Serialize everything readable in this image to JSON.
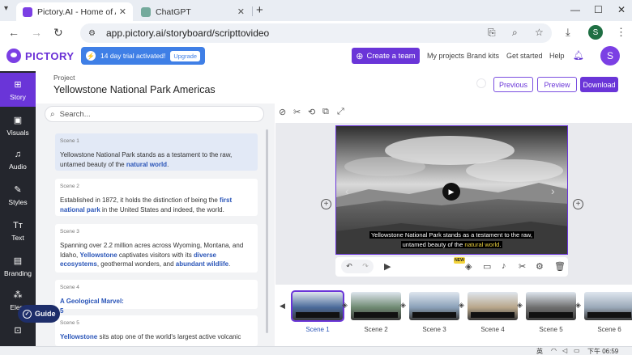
{
  "browser": {
    "tabs": [
      {
        "title": "Pictory.AI - Home of AI Vid",
        "active": true,
        "favicon_color": "#7b3fe4"
      },
      {
        "title": "ChatGPT",
        "active": false,
        "favicon_color": "#74aa9c"
      }
    ],
    "url": "app.pictory.ai/storyboard/scripttovideo",
    "profile_initial": "S"
  },
  "header": {
    "logo_text": "PICTORY",
    "trial_text": "14 day trial activated!",
    "upgrade_label": "Upgrade",
    "create_team_label": "Create a team",
    "links": [
      "My projects",
      "Brand kits",
      "Get started",
      "Help"
    ],
    "avatar_initial": "S"
  },
  "sidebar": {
    "items": [
      {
        "label": "Story",
        "icon": "grid-icon",
        "active": true
      },
      {
        "label": "Visuals",
        "icon": "image-icon",
        "active": false
      },
      {
        "label": "Audio",
        "icon": "audio-icon",
        "active": false
      },
      {
        "label": "Styles",
        "icon": "brush-icon",
        "active": false
      },
      {
        "label": "Text",
        "icon": "text-icon",
        "active": false
      },
      {
        "label": "Branding",
        "icon": "briefcase-icon",
        "active": false
      },
      {
        "label": "Elem",
        "icon": "elements-icon",
        "active": false
      },
      {
        "label": "",
        "icon": "upload-icon",
        "active": false
      }
    ],
    "guide_label": "Guide"
  },
  "project": {
    "label": "Project",
    "title": "Yellowstone National Park Americas Natu",
    "previous_label": "Previous",
    "preview_label": "Preview",
    "download_label": "Download"
  },
  "search": {
    "placeholder": "Search..."
  },
  "scenes": [
    {
      "label": "Scene 1",
      "parts": [
        {
          "t": "Yellowstone National Park stands as a testament to the raw, untamed beauty of the ",
          "hl": false
        },
        {
          "t": "natural world",
          "hl": true
        },
        {
          "t": ".",
          "hl": false
        }
      ]
    },
    {
      "label": "Scene 2",
      "parts": [
        {
          "t": "Established in 1872, it holds the distinction of being the ",
          "hl": false
        },
        {
          "t": "first national park",
          "hl": true
        },
        {
          "t": " in the United States and indeed, the world.",
          "hl": false
        }
      ]
    },
    {
      "label": "Scene 3",
      "parts": [
        {
          "t": "Spanning over 2.2 million acres across Wyoming, Montana, and Idaho, ",
          "hl": false
        },
        {
          "t": "Yellowstone",
          "hl": true
        },
        {
          "t": " captivates visitors with its ",
          "hl": false
        },
        {
          "t": "diverse ecosystems",
          "hl": true
        },
        {
          "t": ", geothermal wonders, and ",
          "hl": false
        },
        {
          "t": "abundant wildlife",
          "hl": true
        },
        {
          "t": ".",
          "hl": false
        }
      ]
    },
    {
      "label": "Scene 4",
      "parts": [
        {
          "t": "A Geological Marvel:",
          "hl": true
        },
        {
          "t": "5",
          "hl": true
        }
      ]
    },
    {
      "label": "Scene 5",
      "parts": [
        {
          "t": "Yellowstone",
          "hl": true
        },
        {
          "t": " sits atop one of the world's largest active volcanic",
          "hl": false
        }
      ]
    }
  ],
  "preview": {
    "caption_line1": "Yellowstone National Park stands as a testament to the raw,",
    "caption_line2_pre": "untamed beauty of the ",
    "caption_highlight": "natural world",
    "caption_line2_post": ".",
    "new_badge": "NEW"
  },
  "timeline": {
    "scenes": [
      "Scene 1",
      "Scene 2",
      "Scene 3",
      "Scene 4",
      "Scene 5",
      "Scene 6"
    ],
    "selected": 0,
    "thumb_colors": [
      "#4a6a9a",
      "#6f8a72",
      "#8aa0b8",
      "#b8a68a",
      "#6e6e6e",
      "#9aa8b8"
    ]
  },
  "taskbar": {
    "ime": "英",
    "time": "下午 06:59"
  }
}
